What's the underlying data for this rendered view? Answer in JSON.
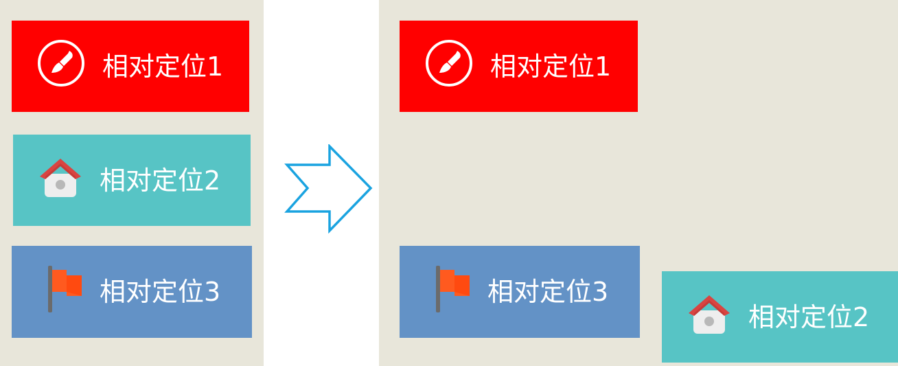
{
  "before": {
    "boxes": [
      {
        "label": "相对定位1",
        "icon": "brush-icon",
        "color": "#ff0000"
      },
      {
        "label": "相对定位2",
        "icon": "home-icon",
        "color": "#57c4c5"
      },
      {
        "label": "相对定位3",
        "icon": "flag-icon",
        "color": "#6392c6"
      }
    ]
  },
  "after": {
    "boxes": [
      {
        "label": "相对定位1",
        "icon": "brush-icon",
        "color": "#ff0000"
      },
      {
        "label": "相对定位3",
        "icon": "flag-icon",
        "color": "#6392c6"
      },
      {
        "label": "相对定位2",
        "icon": "home-icon",
        "color": "#57c4c5"
      }
    ]
  },
  "transition_icon": "chevron-arrow-right-icon",
  "colors": {
    "panel_background": "#e8e6da",
    "arrow_stroke": "#1aa3e0",
    "text": "#ffffff"
  }
}
